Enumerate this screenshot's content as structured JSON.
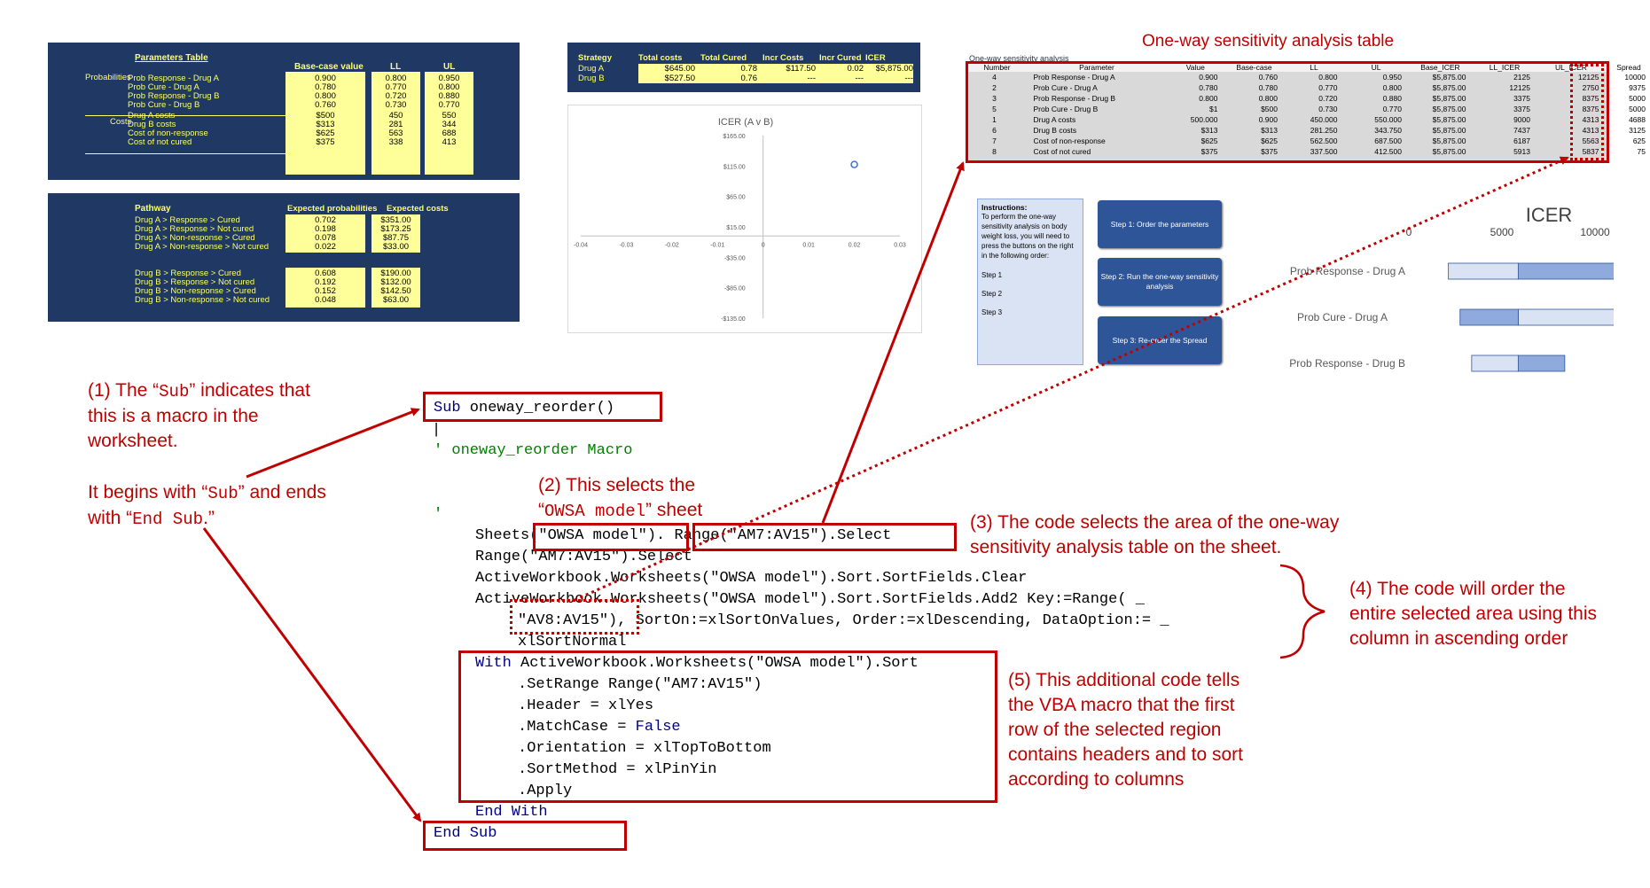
{
  "params_table": {
    "title": "Parameters Table",
    "headers": [
      "Base-case value",
      "LL",
      "UL"
    ],
    "groups": [
      "Probabilities",
      "Costs"
    ],
    "rows": [
      {
        "name": "Prob Response - Drug A",
        "base": "0.900",
        "ll": "0.800",
        "ul": "0.950"
      },
      {
        "name": "Prob Cure - Drug A",
        "base": "0.780",
        "ll": "0.770",
        "ul": "0.800"
      },
      {
        "name": "Prob Response - Drug B",
        "base": "0.800",
        "ll": "0.720",
        "ul": "0.880"
      },
      {
        "name": "Prob Cure - Drug B",
        "base": "0.760",
        "ll": "0.730",
        "ul": "0.770"
      },
      {
        "name": "Drug A costs",
        "base": "$500",
        "ll": "450",
        "ul": "550"
      },
      {
        "name": "Drug B costs",
        "base": "$313",
        "ll": "281",
        "ul": "344"
      },
      {
        "name": "Cost of non-response",
        "base": "$625",
        "ll": "563",
        "ul": "688"
      },
      {
        "name": "Cost of not cured",
        "base": "$375",
        "ll": "338",
        "ul": "413"
      }
    ]
  },
  "pathway_table": {
    "headers": [
      "Pathway",
      "Expected probabilities",
      "Expected costs"
    ],
    "rows_a": [
      {
        "name": "Drug A > Response > Cured",
        "prob": "0.702",
        "cost": "$351.00"
      },
      {
        "name": "Drug A > Response > Not cured",
        "prob": "0.198",
        "cost": "$173.25"
      },
      {
        "name": "Drug A > Non-response > Cured",
        "prob": "0.078",
        "cost": "$87.75"
      },
      {
        "name": "Drug A > Non-response > Not cured",
        "prob": "0.022",
        "cost": "$33.00"
      }
    ],
    "rows_b": [
      {
        "name": "Drug B > Response > Cured",
        "prob": "0.608",
        "cost": "$190.00"
      },
      {
        "name": "Drug B > Response > Not cured",
        "prob": "0.192",
        "cost": "$132.00"
      },
      {
        "name": "Drug B > Non-response > Cured",
        "prob": "0.152",
        "cost": "$142.50"
      },
      {
        "name": "Drug B > Non-response > Not cured",
        "prob": "0.048",
        "cost": "$63.00"
      }
    ]
  },
  "strategy_table": {
    "headers": [
      "Strategy",
      "Total costs",
      "Total Cured",
      "Incr Costs",
      "Incr Cured",
      "ICER"
    ],
    "rows": [
      [
        "Drug A",
        "$645.00",
        "0.78",
        "$117.50",
        "0.02",
        "$5,875.00"
      ],
      [
        "Drug B",
        "$527.50",
        "0.76",
        "---",
        "---",
        "---"
      ]
    ]
  },
  "scatter": {
    "title": "ICER (A v B)",
    "x_ticks": [
      "-0.04",
      "-0.03",
      "-0.02",
      "-0.01",
      "0",
      "0.01",
      "0.02",
      "0.03"
    ],
    "y_ticks": [
      "$165.00",
      "$115.00",
      "$65.00",
      "$15.00",
      "-$35.00",
      "-$85.00",
      "-$135.00"
    ]
  },
  "chart_data": [
    {
      "type": "scatter",
      "title": "ICER (A v B)",
      "xlim": [
        -0.04,
        0.03
      ],
      "ylim": [
        -135,
        165
      ],
      "points": [
        {
          "x": 0.02,
          "y": 117.5
        }
      ]
    },
    {
      "type": "bar",
      "title": "ICER",
      "orientation": "horizontal",
      "categories": [
        "Prob Response - Drug A",
        "Prob Cure - Drug A",
        "Prob Response - Drug B"
      ],
      "x_ticks": [
        "0",
        "5000",
        "10000"
      ],
      "xlim": [
        0,
        10000
      ],
      "low": [
        2125,
        12125,
        3375
      ],
      "high": [
        12125,
        2750,
        8375
      ],
      "base": 5875
    }
  ],
  "owsa": {
    "caption": "One-way sensitivity analysis table",
    "small_title": "One-way sensitivity analysis",
    "headers": [
      "Number",
      "Parameter",
      "Value",
      "Base-case",
      "LL",
      "UL",
      "Base_ICER",
      "LL_ICER",
      "UL_ICER",
      "Spread"
    ],
    "rows": [
      [
        "4",
        "Prob Response - Drug A",
        "0.900",
        "0.760",
        "0.800",
        "0.950",
        "$5,875.00",
        "2125",
        "12125",
        "10000"
      ],
      [
        "2",
        "Prob Cure - Drug A",
        "0.780",
        "0.780",
        "0.770",
        "0.800",
        "$5,875.00",
        "12125",
        "2750",
        "9375"
      ],
      [
        "3",
        "Prob Response - Drug B",
        "0.800",
        "0.800",
        "0.720",
        "0.880",
        "$5,875.00",
        "3375",
        "8375",
        "5000"
      ],
      [
        "5",
        "Prob Cure - Drug B",
        "$1",
        "$500",
        "0.730",
        "0.770",
        "$5,875.00",
        "3375",
        "8375",
        "5000"
      ],
      [
        "1",
        "Drug A costs",
        "500.000",
        "0.900",
        "450.000",
        "550.000",
        "$5,875.00",
        "9000",
        "4313",
        "4688"
      ],
      [
        "6",
        "Drug B costs",
        "$313",
        "$313",
        "281.250",
        "343.750",
        "$5,875.00",
        "7437",
        "4313",
        "3125"
      ],
      [
        "7",
        "Cost of non-response",
        "$625",
        "$625",
        "562.500",
        "687.500",
        "$5,875.00",
        "6187",
        "5563",
        "625"
      ],
      [
        "8",
        "Cost of not cured",
        "$375",
        "$375",
        "337.500",
        "412.500",
        "$5,875.00",
        "5913",
        "5837",
        "75"
      ]
    ]
  },
  "instructions": {
    "title": "Instructions:",
    "body": "To perform the one-way sensitivity analysis on body weight loss, you will need to press the buttons on the right in the following order:",
    "steps": [
      "Step 1",
      "Step 2",
      "Step 3"
    ]
  },
  "buttons": [
    "Step 1: Order the parameters",
    "Step 2: Run the one-way sensitivity analysis",
    "Step 3: Re-order the Spread"
  ],
  "tornado": {
    "title": "ICER",
    "x_ticks": [
      "0",
      "5000",
      "10000"
    ],
    "labels": [
      "Prob Response - Drug A",
      "Prob Cure - Drug A",
      "Prob Response - Drug B"
    ]
  },
  "code": {
    "sub": "Sub oneway_reorder()",
    "comment1": "'",
    "comment2": "' oneway_reorder Macro",
    "comment3": "'",
    "comment4": "'",
    "l1a": "Sheets(\"OWSA model\")",
    "l1b": ".",
    "l1c": "Range(\"AM7:AV15\").Select",
    "l2": "Range(\"AM7:AV15\").Select",
    "l3": "ActiveWorkbook.Worksheets(\"OWSA model\").Sort.SortFields.Clear",
    "l4": "ActiveWorkbook.Worksheets(\"OWSA model\").Sort.SortFields.Add2 Key:=Range( _",
    "l5a": "\"AV8:AV15\")",
    "l5b": ", SortOn:=xlSortOnValues, Order:=xlDescending, DataOption:= _",
    "l6": "xlSortNormal",
    "l7kw": "With",
    "l7": " ActiveWorkbook.Worksheets(\"OWSA model\").Sort",
    "l8": ".SetRange Range(\"AM7:AV15\")",
    "l9": ".Header = xlYes",
    "l10a": ".MatchCase = ",
    "l10kw": "False",
    "l11": ".Orientation = xlTopToBottom",
    "l12": ".SortMethod = xlPinYin",
    "l13": ".Apply",
    "l14": "End With",
    "l15": "End Sub"
  },
  "notes": {
    "n1a": "(1) The “",
    "n1code": "Sub",
    "n1b": "” indicates that",
    "n1c": "this is a macro in the",
    "n1d": "worksheet.",
    "n1e": "It begins with “",
    "n1ecode": "Sub",
    "n1f": "” and ends",
    "n1g": "with “",
    "n1gcode": "End Sub",
    "n1h": ".”",
    "n2a": "(2) This selects the",
    "n2b": "“",
    "n2code": "OWSA model",
    "n2c": "” sheet",
    "n3a": "(3) The code selects the area of the one-way",
    "n3b": "sensitivity analysis table on the sheet.",
    "n4a": "(4) The code will order the",
    "n4b": "entire selected area using this",
    "n4c": "column in ascending order",
    "n5a": "(5) This additional code tells",
    "n5b": "the VBA macro that the first",
    "n5c": "row of the selected region",
    "n5d": "contains headers and to sort",
    "n5e": "according to columns"
  },
  "colors": {
    "navy": "#1f3864",
    "yellow": "#ffff99",
    "red": "#c00000",
    "button": "#2e5597"
  }
}
